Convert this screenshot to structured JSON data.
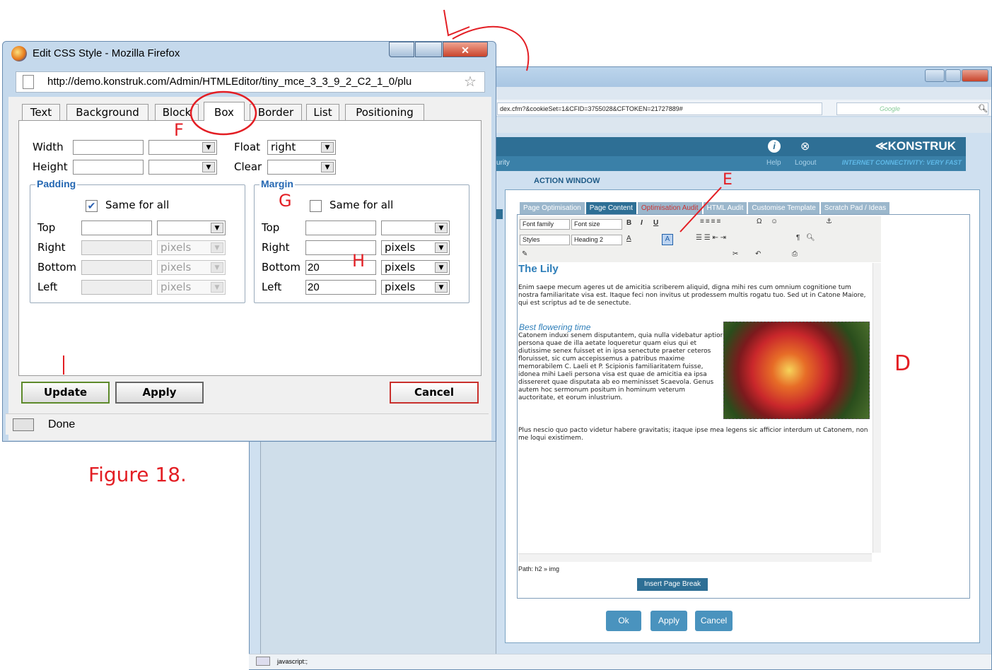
{
  "back_window": {
    "url": "dex.cfm?&cookieSet=1&CFID=3755028&CFTOKEN=21727889#",
    "search_placeholder": "Google",
    "brand": "≪KONSTRUK",
    "help": "Help",
    "logout": "Logout",
    "security": "urity",
    "connectivity": "INTERNET CONNECTIVITY: VERY FAST",
    "action_window": "ACTION WINDOW",
    "tabs": [
      "Page Optimisation",
      "Page Content",
      "Optimisation Audit",
      "HTML Audit",
      "Customise Template",
      "Scratch Pad / Ideas"
    ],
    "toolbar": {
      "font_family": "Font family",
      "font_size": "Font size",
      "styles": "Styles",
      "heading": "Heading 2"
    },
    "content": {
      "heading": "The Lily",
      "para1": "Enim saepe mecum ageres ut de amicitia scriberem aliquid, digna mihi res cum omnium cognitione tum nostra familiaritate visa est. Itaque feci non invitus ut prodessem multis rogatu tuo. Sed ut in Catone Maiore, qui est scriptus ad te de senectute.",
      "subheading": "Best flowering time",
      "para2": "Catonem induxi senem disputantem, quia nulla videbatur aptior persona quae de illa aetate loqueretur quam eius qui et diutissime senex fuisset et in ipsa senectute praeter ceteros floruisset, sic cum accepissemus a patribus maxime memorabilem C. Laeli et P. Scipionis familiaritatem fuisse, idonea mihi Laeli persona visa est quae de amicitia ea ipsa dissereret quae disputata ab eo meminisset Scaevola. Genus autem hoc sermonum positum in hominum veterum auctoritate, et eorum inlustrium.",
      "para3": "Plus nescio quo pacto videtur habere gravitatis; itaque ipse mea legens sic afficior interdum ut Catonem, non me loqui existimem."
    },
    "path": "Path: h2 » img",
    "insert_page_break": "Insert Page Break",
    "ok": "Ok",
    "apply": "Apply",
    "cancel": "Cancel",
    "status": "javascript:;"
  },
  "popup": {
    "title": "Edit CSS Style - Mozilla Firefox",
    "url": "http://demo.konstruk.com/Admin/HTMLEditor/tiny_mce_3_3_9_2_C2_1_0/plu",
    "tabs": [
      "Text",
      "Background",
      "Block",
      "Box",
      "Border",
      "List",
      "Positioning"
    ],
    "width_label": "Width",
    "height_label": "Height",
    "float_label": "Float",
    "float_value": "right",
    "clear_label": "Clear",
    "padding": {
      "legend": "Padding",
      "same_for_all": "Same for all",
      "checked": true,
      "rows": [
        {
          "label": "Top",
          "value": "",
          "unit": ""
        },
        {
          "label": "Right",
          "value": "",
          "unit": "pixels"
        },
        {
          "label": "Bottom",
          "value": "",
          "unit": "pixels"
        },
        {
          "label": "Left",
          "value": "",
          "unit": "pixels"
        }
      ]
    },
    "margin": {
      "legend": "Margin",
      "same_for_all": "Same for all",
      "checked": false,
      "rows": [
        {
          "label": "Top",
          "value": "",
          "unit": ""
        },
        {
          "label": "Right",
          "value": "",
          "unit": "pixels"
        },
        {
          "label": "Bottom",
          "value": "20",
          "unit": "pixels"
        },
        {
          "label": "Left",
          "value": "20",
          "unit": "pixels"
        }
      ]
    },
    "update": "Update",
    "apply": "Apply",
    "cancel": "Cancel",
    "status": "Done"
  },
  "annotations": {
    "D": "D",
    "E": "E",
    "F": "F",
    "G": "G",
    "H": "H",
    "I": "I",
    "caption": "Figure 18."
  },
  "colors": {
    "annotation": "#e31e24",
    "brand_bar": "#2e6f95"
  }
}
